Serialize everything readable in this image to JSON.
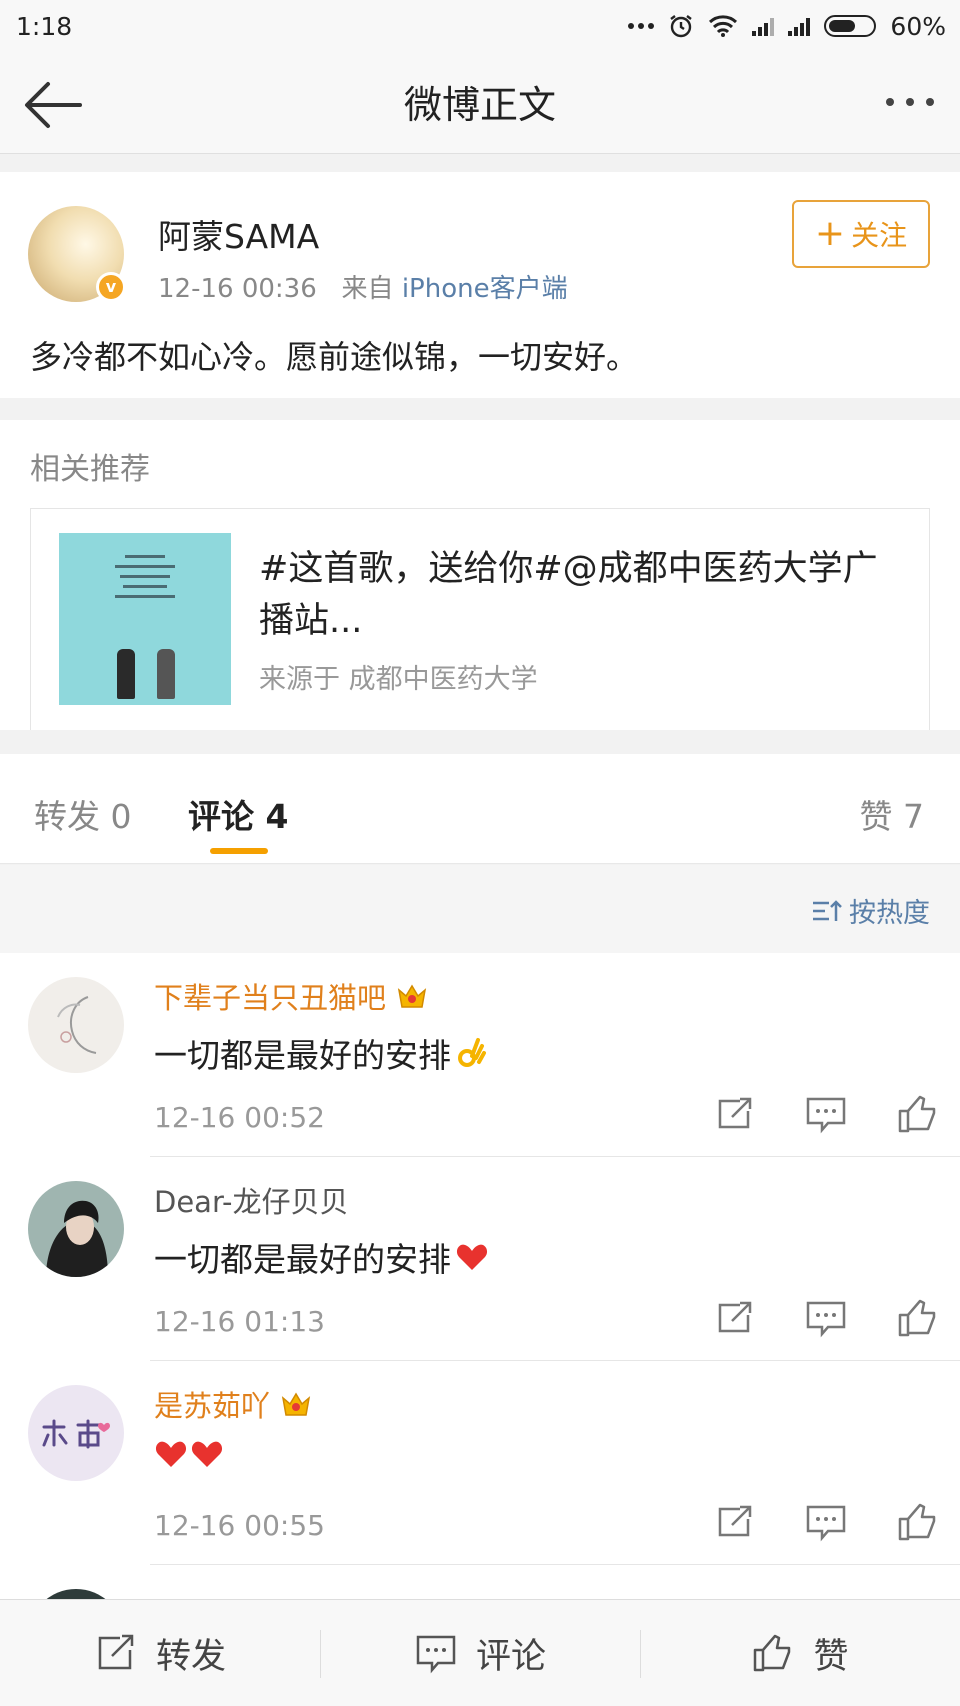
{
  "status_bar": {
    "time": "1:18",
    "battery": "60%"
  },
  "nav": {
    "title": "微博正文"
  },
  "post": {
    "author": "阿蒙SAMA",
    "time": "12-16 00:36",
    "source_prefix": "来自",
    "source": "iPhone客户端",
    "follow_label": "关注",
    "text": "多冷都不如心冷。愿前途似锦，一切安好。"
  },
  "related": {
    "heading": "相关推荐",
    "card_title": "#这首歌，送给你#@成都中医药大学广播站...",
    "card_source": "来源于 成都中医药大学",
    "accent_color": "#8fd8dc"
  },
  "tabs": {
    "repost": "转发 0",
    "comment": "评论 4",
    "like": "赞 7"
  },
  "sort_label": "按热度",
  "comments": [
    {
      "name": "下辈子当只丑猫吧",
      "text": "一切都是最好的安排",
      "emoji": "ok-hand",
      "time": "12-16 00:52",
      "crown": true
    },
    {
      "name": "Dear-龙仔贝贝",
      "text": "一切都是最好的安排",
      "emoji": "heart",
      "time": "12-16 01:13",
      "crown": false
    },
    {
      "name": "是苏茹吖",
      "text": "",
      "emoji": "two-hearts",
      "time": "12-16 00:55",
      "crown": true
    }
  ],
  "bottom_bar": {
    "repost": "转发",
    "comment": "评论",
    "like": "赞"
  },
  "colors": {
    "accent": "#f5a000",
    "link": "#5a7fa8",
    "vip_name": "#e0801c"
  }
}
